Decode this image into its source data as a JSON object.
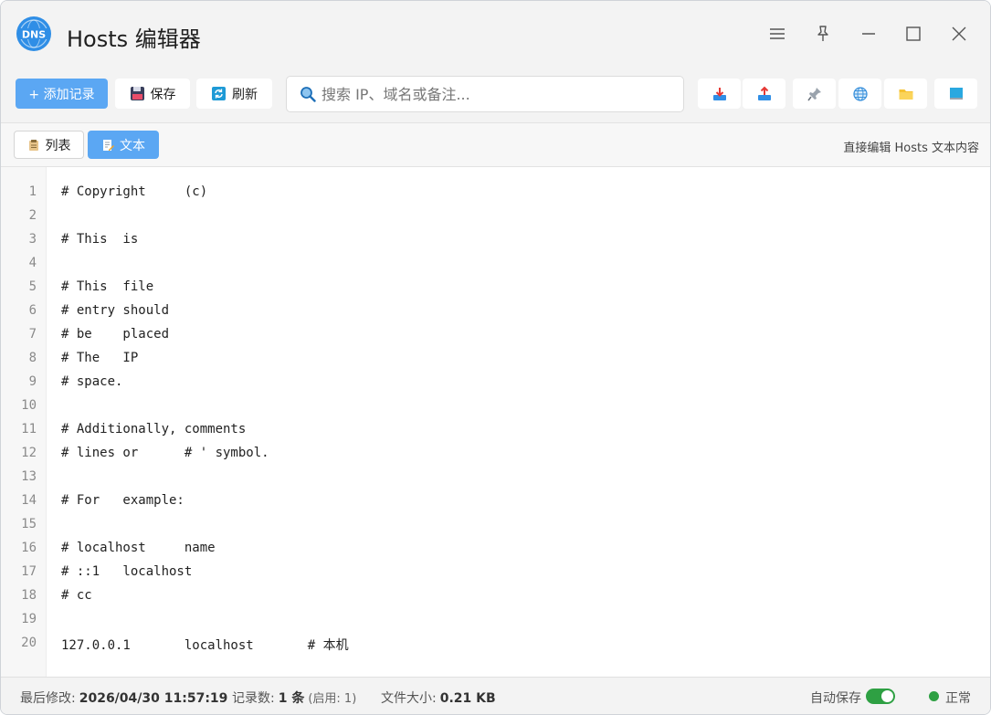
{
  "window": {
    "title": "Hosts 编辑器",
    "logo_text": "DNS"
  },
  "toolbar": {
    "add_label": "+ 添加记录",
    "save_label": "保存",
    "refresh_label": "刷新",
    "search_placeholder": "搜索 IP、域名或备注..."
  },
  "tabs": {
    "list_label": "列表",
    "text_label": "文本",
    "active": "text",
    "hint": "直接编辑 Hosts 文本内容"
  },
  "editor": {
    "lines": [
      {
        "no": "1",
        "text": "# Copyright     (c)"
      },
      {
        "no": "2",
        "text": ""
      },
      {
        "no": "3",
        "text": "# This  is"
      },
      {
        "no": "4",
        "text": ""
      },
      {
        "no": "5",
        "text": "# This  file"
      },
      {
        "no": "6",
        "text": "# entry should"
      },
      {
        "no": "7",
        "text": "# be    placed"
      },
      {
        "no": "8",
        "text": "# The   IP"
      },
      {
        "no": "9",
        "text": "# space."
      },
      {
        "no": "10",
        "text": ""
      },
      {
        "no": "11",
        "text": "# Additionally, comments"
      },
      {
        "no": "12",
        "text": "# lines or      # ' symbol."
      },
      {
        "no": "13",
        "text": ""
      },
      {
        "no": "14",
        "text": "# For   example:"
      },
      {
        "no": "15",
        "text": ""
      },
      {
        "no": "16",
        "text": "# localhost     name"
      },
      {
        "no": "17",
        "text": "# ::1   localhost"
      },
      {
        "no": "18",
        "text": "# cc"
      },
      {
        "no": "19",
        "text": ""
      },
      {
        "no": "20",
        "text": "127.0.0.1       localhost       # 本机"
      }
    ]
  },
  "status": {
    "modified_label": "最后修改:",
    "modified_value": "2026/04/30 11:57:19",
    "records_label": "记录数:",
    "records_value": "1 条",
    "records_enabled": "(启用: 1)",
    "size_label": "文件大小:",
    "size_value": "0.21 KB",
    "autosave_label": "自动保存",
    "autosave_on": true,
    "state_label": "正常"
  },
  "colors": {
    "accent": "#5ba7f3",
    "ok": "#2ea043"
  }
}
